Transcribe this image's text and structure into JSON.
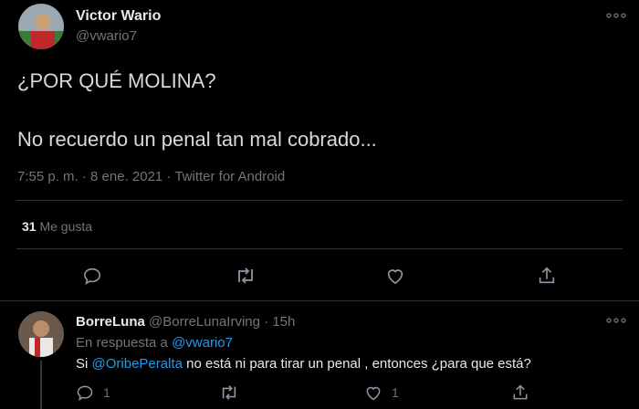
{
  "tweet": {
    "author_name": "Victor Wario",
    "author_handle": "@vwario7",
    "text_line1": "¿POR QUÉ MOLINA?",
    "text_line2": "No recuerdo un penal tan mal cobrado...",
    "timestamp": "7:55 p. m. · 8 ene. 2021 · Twitter for Android",
    "likes_count": "31",
    "likes_label": "Me gusta"
  },
  "reply": {
    "author_name": "BorreLuna",
    "author_handle": "@BorreLunaIrving",
    "separator": "·",
    "time": "15h",
    "reply_to_prefix": "En respuesta a",
    "reply_to_handle": "@vwario7",
    "text_prefix": "Si",
    "text_mention": "@OribePeralta",
    "text_rest": "no está ni para tirar un penal , entonces ¿para que está?",
    "reply_count": "1",
    "like_count": "1"
  },
  "icons": {
    "more": "more-icon",
    "reply": "reply-icon",
    "retweet": "retweet-icon",
    "like": "heart-icon",
    "share": "share-icon"
  }
}
